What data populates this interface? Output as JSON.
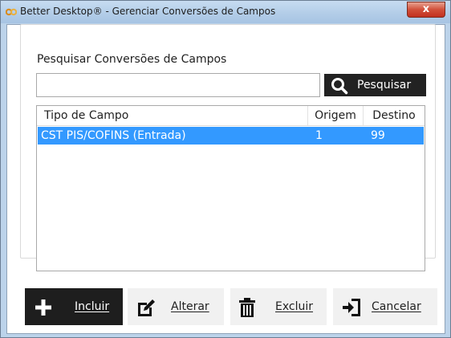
{
  "window": {
    "title": "Better Desktop® - Gerenciar Conversões de Campos",
    "close_label": "x"
  },
  "search": {
    "label": "Pesquisar Conversões de Campos",
    "value": "",
    "placeholder": "",
    "button_label": "Pesquisar"
  },
  "grid": {
    "columns": [
      "Tipo de Campo",
      "Origem",
      "Destino"
    ],
    "rows": [
      {
        "tipo": "CST PIS/COFINS (Entrada)",
        "origem": "1",
        "destino": "99",
        "selected": true
      }
    ]
  },
  "actions": {
    "incluir": "Incluir",
    "alterar": "Alterar",
    "excluir": "Excluir",
    "cancelar": "Cancelar"
  },
  "colors": {
    "selection": "#3399ff",
    "primary_button": "#1e1e1e",
    "secondary_button": "#f1f1f1"
  }
}
